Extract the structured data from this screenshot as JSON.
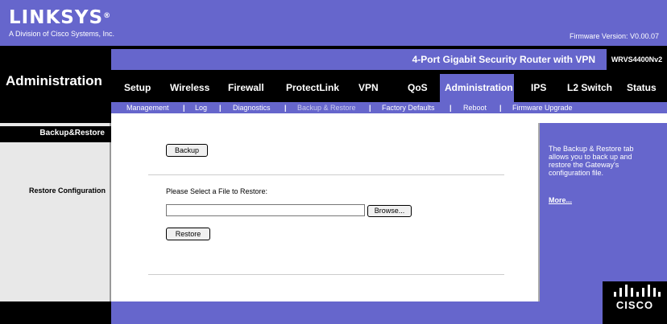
{
  "header": {
    "logo_text": "Linksys",
    "logo_sub": "A Division of Cisco Systems, Inc.",
    "firmware_version": "Firmware Version: V0.00.07",
    "product_name": "4-Port Gigabit Security Router with VPN",
    "model": "WRVS4400Nv2",
    "page_title": "Administration"
  },
  "tabs": [
    {
      "label": "Setup"
    },
    {
      "label": "Wireless"
    },
    {
      "label": "Firewall"
    },
    {
      "label": "ProtectLink"
    },
    {
      "label": "VPN"
    },
    {
      "label": "QoS"
    },
    {
      "label": "Administration",
      "active": true
    },
    {
      "label": "IPS"
    },
    {
      "label": "L2 Switch"
    },
    {
      "label": "Status"
    }
  ],
  "subtabs": [
    {
      "label": "Management"
    },
    {
      "label": "Log"
    },
    {
      "label": "Diagnostics"
    },
    {
      "label": "Backup & Restore",
      "active": true
    },
    {
      "label": "Factory Defaults"
    },
    {
      "label": "Reboot"
    },
    {
      "label": "Firmware Upgrade"
    }
  ],
  "left_panel": {
    "section_header": "Backup&Restore",
    "restore_config_label": "Restore Configuration"
  },
  "main": {
    "backup_button": "Backup",
    "restore_prompt": "Please Select a File to Restore:",
    "file_input_value": "",
    "browse_button": "Browse...",
    "restore_button": "Restore"
  },
  "help": {
    "text": "The Backup & Restore tab allows you to back up and restore the Gateway's configuration file.",
    "more_link": "More..."
  },
  "cisco": {
    "word": "CISCO"
  },
  "colors": {
    "brand_purple": "#6666cc",
    "black": "#000000",
    "left_panel_gray": "#e8e8e8"
  }
}
